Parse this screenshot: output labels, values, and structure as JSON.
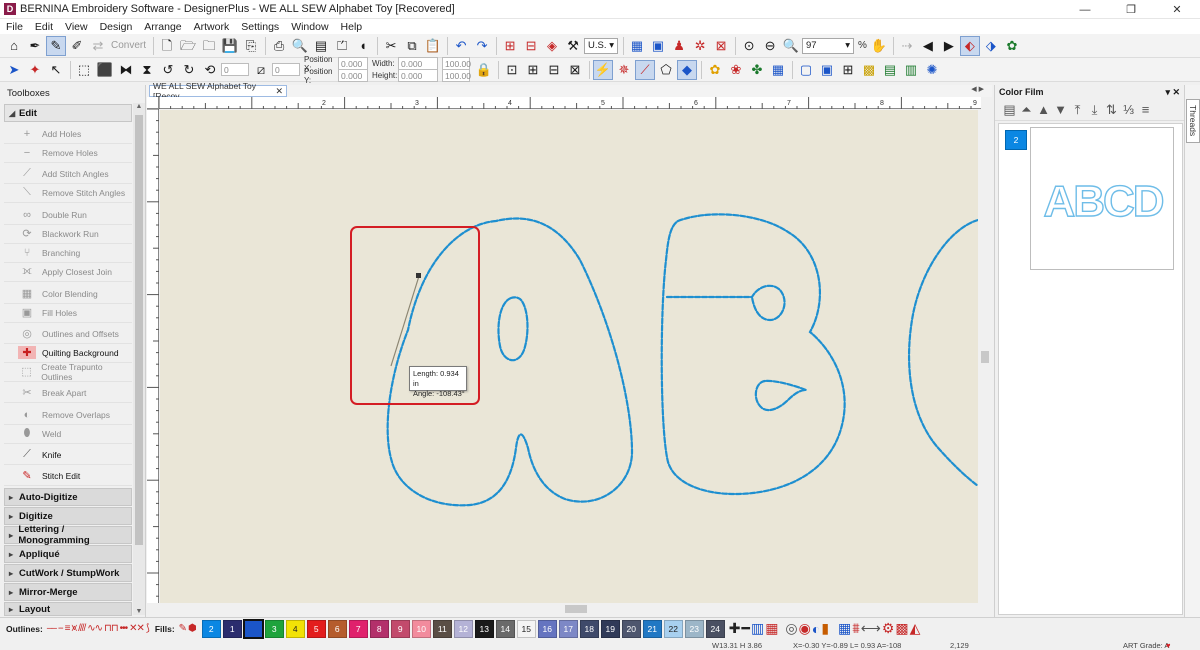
{
  "window": {
    "app_title": "BERNINA Embroidery Software - DesignerPlus - WE ALL SEW Alphabet Toy [Recovered]",
    "logo_letter": "D",
    "minimize": "—",
    "maximize": "❐",
    "close": "✕"
  },
  "menu": [
    "File",
    "Edit",
    "View",
    "Design",
    "Arrange",
    "Artwork",
    "Settings",
    "Window",
    "Help"
  ],
  "toolbar": {
    "convert_label": "Convert",
    "units_value": "U.S.",
    "zoom_value": "97",
    "zoom_unit": "%",
    "position_x_label": "Position X:",
    "position_y_label": "Position Y:",
    "position_x_value": "0.000",
    "position_y_value": "0.000",
    "width_label": "Width:",
    "height_label": "Height:",
    "width_value": "0.000",
    "height_value": "0.000",
    "width_pct": "100.00",
    "height_pct": "100.00",
    "rotate_value": "0",
    "slant_value": "0"
  },
  "toolboxes": {
    "header": "Toolboxes",
    "edit_section": "Edit",
    "tools": [
      {
        "label": "Add Holes",
        "icon": "add-holes-icon",
        "glyph": "⬤"
      },
      {
        "label": "Remove Holes",
        "icon": "remove-holes-icon",
        "glyph": "◯"
      },
      {
        "label": "Add Stitch Angles",
        "icon": "add-stitch-angles-icon",
        "glyph": "⟋"
      },
      {
        "label": "Remove Stitch Angles",
        "icon": "remove-stitch-angles-icon",
        "glyph": "⟍"
      },
      {
        "label": "Double Run",
        "icon": "double-run-icon",
        "glyph": "∞"
      },
      {
        "label": "Blackwork Run",
        "icon": "blackwork-run-icon",
        "glyph": "⟳"
      },
      {
        "label": "Branching",
        "icon": "branching-icon",
        "glyph": "⑂"
      },
      {
        "label": "Apply Closest Join",
        "icon": "closest-join-icon",
        "glyph": "⟗"
      },
      {
        "label": "Color Blending",
        "icon": "color-blending-icon",
        "glyph": "▦"
      },
      {
        "label": "Fill Holes",
        "icon": "fill-holes-icon",
        "glyph": "▣"
      },
      {
        "label": "Outlines and Offsets",
        "icon": "outlines-offsets-icon",
        "glyph": "◎"
      },
      {
        "label": "Quilting Background",
        "icon": "quilting-background-icon",
        "glyph": "▩"
      },
      {
        "label": "Create Trapunto Outlines",
        "icon": "trapunto-icon",
        "glyph": "⬚"
      },
      {
        "label": "Break Apart",
        "icon": "break-apart-icon",
        "glyph": "✂"
      },
      {
        "label": "Remove Overlaps",
        "icon": "remove-overlaps-icon",
        "glyph": "◐"
      },
      {
        "label": "Weld",
        "icon": "weld-icon",
        "glyph": "⬮"
      },
      {
        "label": "Knife",
        "icon": "knife-icon",
        "glyph": "🔪"
      },
      {
        "label": "Stitch Edit",
        "icon": "stitch-edit-icon",
        "glyph": "✎"
      }
    ],
    "sections": [
      "Auto-Digitize",
      "Digitize",
      "Lettering / Monogramming",
      "Appliqué",
      "CutWork / StumpWork",
      "Mirror-Merge",
      "Layout"
    ]
  },
  "document": {
    "tab_title": "WE ALL SEW Alphabet Toy [Recov...",
    "tab_close": "✕",
    "tooltip_length": "Length:  0.934 in",
    "tooltip_angle": "Angle:  -108.43°",
    "ruler_marks": [
      "2",
      "3",
      "4",
      "5",
      "6",
      "7",
      "8",
      "9"
    ],
    "stitch_color": "#1e8fd0",
    "highlight_color": "#d41d24"
  },
  "color_film": {
    "title": "Color Film",
    "pin": "▾ ✕",
    "swatch_number": "2",
    "preview_text": "ABCD",
    "threads_tab": "Threads"
  },
  "color_bar": {
    "outlines_label": "Outlines:",
    "fills_label": "Fills:",
    "chips": [
      {
        "n": "2",
        "c": "#0b87e3"
      },
      {
        "n": "1",
        "c": "#2b2d6e"
      },
      {
        "n": "",
        "c": "#1b55c8"
      },
      {
        "n": "3",
        "c": "#1ea33c"
      },
      {
        "n": "4",
        "c": "#f2e206"
      },
      {
        "n": "5",
        "c": "#e31d1d"
      },
      {
        "n": "6",
        "c": "#b55c2c"
      },
      {
        "n": "7",
        "c": "#e0216c"
      },
      {
        "n": "8",
        "c": "#b3306b"
      },
      {
        "n": "9",
        "c": "#c24a6c"
      },
      {
        "n": "10",
        "c": "#f28b9d"
      },
      {
        "n": "11",
        "c": "#5a4e45"
      },
      {
        "n": "12",
        "c": "#b4b2d6"
      },
      {
        "n": "13",
        "c": "#1a1a1a"
      },
      {
        "n": "14",
        "c": "#6a6a6a"
      },
      {
        "n": "15",
        "c": "#f4f4f4"
      },
      {
        "n": "16",
        "c": "#6574c0"
      },
      {
        "n": "17",
        "c": "#7d88c6"
      },
      {
        "n": "18",
        "c": "#3f4a6a"
      },
      {
        "n": "19",
        "c": "#303a58"
      },
      {
        "n": "20",
        "c": "#4e566e"
      },
      {
        "n": "21",
        "c": "#2178c4"
      },
      {
        "n": "22",
        "c": "#a8d0ef"
      },
      {
        "n": "23",
        "c": "#9cb6c8"
      },
      {
        "n": "24",
        "c": "#4a5062"
      }
    ],
    "selected_index": 2
  },
  "status": {
    "size": "W13.31  H 3.86",
    "coords": "X=-0.30  Y=-0.89  L= 0.93  A=-108",
    "stitches": "2,129",
    "art_grade": "ART Grade: A"
  }
}
